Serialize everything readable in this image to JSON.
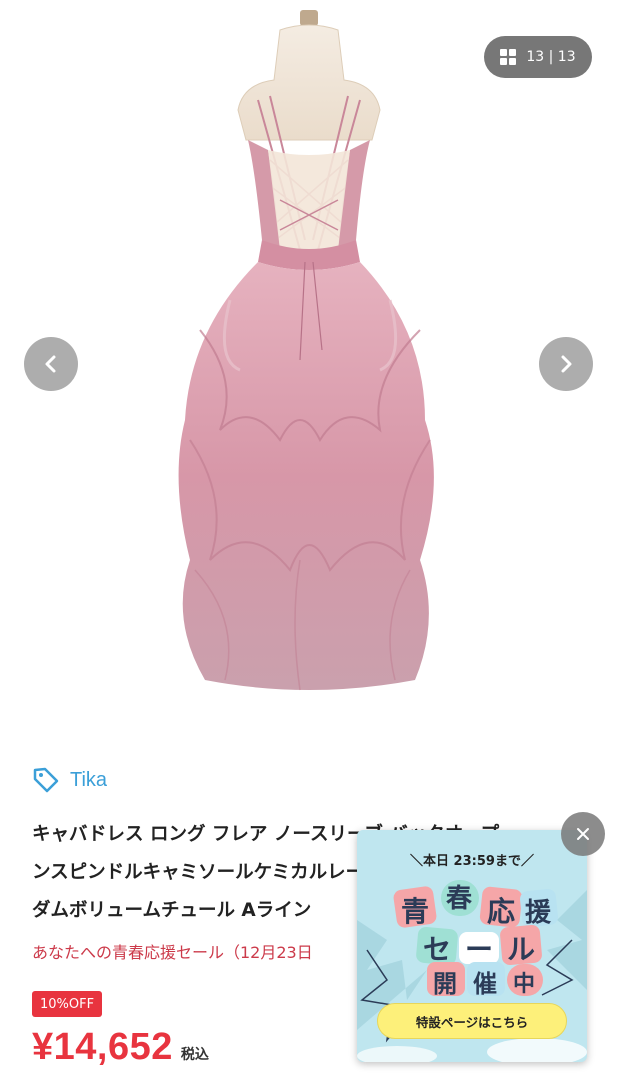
{
  "gallery": {
    "counter": "13 | 13",
    "grid_icon": "grid-icon",
    "prev_icon": "chevron-left-icon",
    "next_icon": "chevron-right-icon"
  },
  "product": {
    "brand": "Tika",
    "brand_icon": "tag-icon",
    "title_lines": [
      "キャバドレス ロング フレア ノースリーブ バックオープ",
      "ンスピンドルキャミソールケミカルレース ティアード",
      "ダムボリュームチュール Aライン"
    ],
    "sale_text": "あなたへの青春応援セール（12月23日",
    "discount_badge": "10%OFF",
    "price": "¥14,652",
    "tax_label": "税込"
  },
  "promo": {
    "top_text": "＼本日 23:59まで／",
    "line1": [
      "青",
      "春",
      "応",
      "援"
    ],
    "line2": [
      "セ",
      "ー",
      "ル"
    ],
    "line3": [
      "開",
      "催",
      "中"
    ],
    "button_label": "特設ページはこちら",
    "close_icon": "close-icon"
  },
  "colors": {
    "accent_red": "#e8343f",
    "brand_blue": "#3b9fd8",
    "dress_pink": "#d99aaa",
    "promo_bg": "#bfe6ef",
    "promo_button": "#fdf07a"
  }
}
